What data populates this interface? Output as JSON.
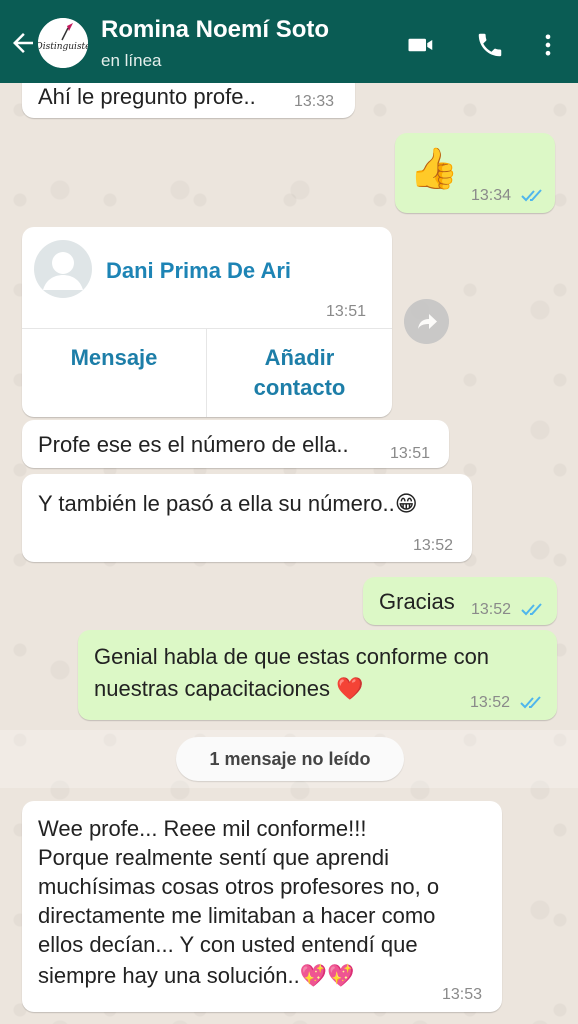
{
  "header": {
    "contact_name": "Romina Noemí Soto",
    "status": "en línea",
    "avatar_text": "Distinguiste",
    "color": "#0a5c54"
  },
  "messages": [
    {
      "id": "m1",
      "dir": "in",
      "text": "Ahí le pregunto profe..",
      "time": "13:33"
    },
    {
      "id": "m2",
      "dir": "out",
      "text": "👍",
      "time": "13:34",
      "read": true
    },
    {
      "id": "m3",
      "dir": "in",
      "type": "contact",
      "contact_name": "Dani Prima De Ari",
      "time": "13:51",
      "actions": [
        "Mensaje",
        "Añadir contacto"
      ]
    },
    {
      "id": "m4",
      "dir": "in",
      "text": "Profe ese es el número de ella..",
      "time": "13:51"
    },
    {
      "id": "m5",
      "dir": "in",
      "text": "Y también le pasó a ella su número..😁",
      "time": "13:52"
    },
    {
      "id": "m6",
      "dir": "out",
      "text": "Gracias",
      "time": "13:52",
      "read": true
    },
    {
      "id": "m7",
      "dir": "out",
      "lines": [
        "Genial habla de que estas conforme con",
        "nuestras capacitaciones ❤️"
      ],
      "time": "13:52",
      "read": true
    },
    {
      "id": "m8",
      "dir": "in",
      "lines": [
        "Wee profe... Reee mil conforme!!!",
        "Porque realmente sentí que aprendi",
        "muchísimas cosas otros profesores no, o",
        "directamente me limitaban a hacer como",
        "ellos decían... Y con usted entendí que",
        "siempre hay una solución..💖💖"
      ],
      "time": "13:53"
    }
  ],
  "unread_label": "1 mensaje no leído",
  "colors": {
    "incoming": "#ffffff",
    "outgoing": "#dcf8c6",
    "link": "#1d84b5",
    "read_ticks": "#4fb6ec"
  },
  "icons": [
    "back-arrow-icon",
    "video-call-icon",
    "phone-icon",
    "more-vert-icon",
    "forward-icon",
    "contact-avatar-icon",
    "double-check-icon"
  ]
}
